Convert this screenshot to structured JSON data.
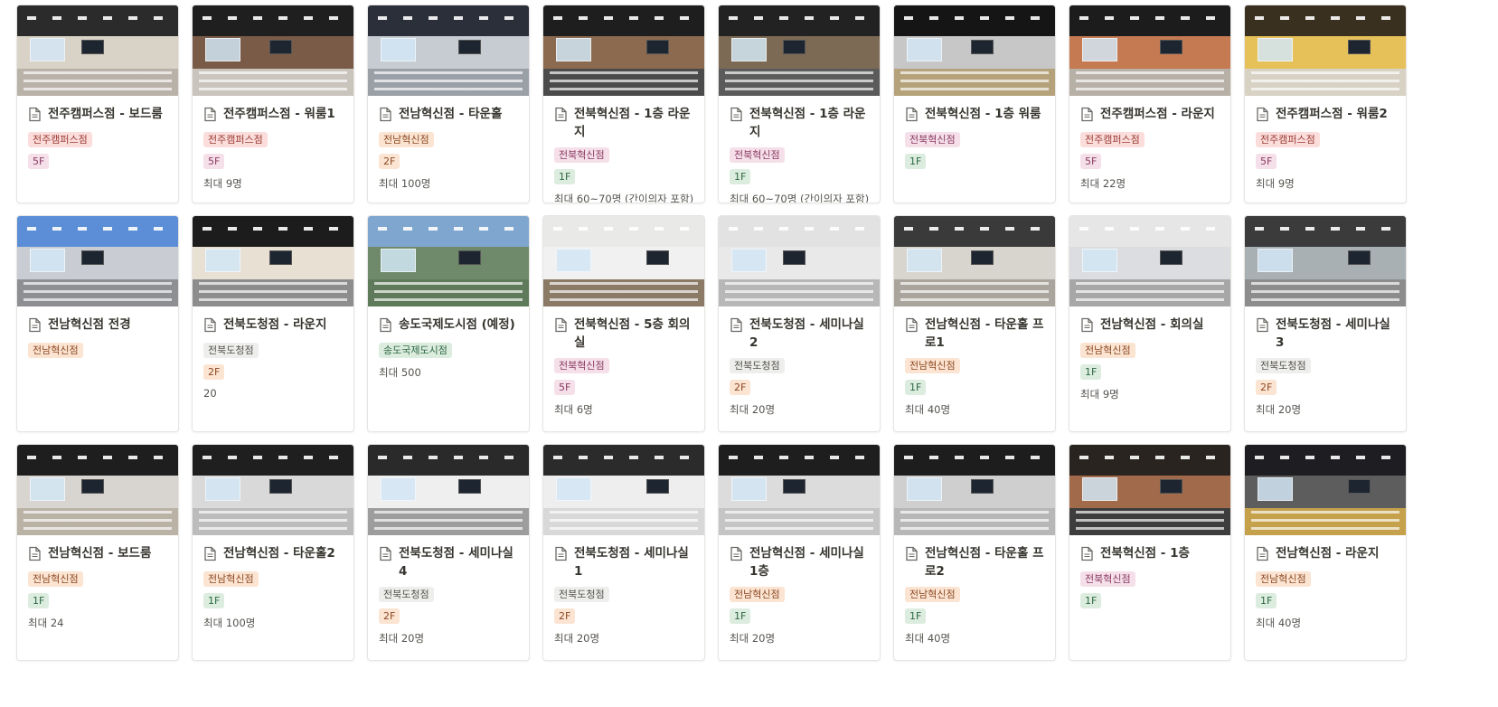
{
  "colors": {
    "tag_jeonnam": "#fbe4d2",
    "tag_jeonbuk": "#f5e0e9",
    "tag_jeonju": "#fbdedc",
    "tag_floor": "#dcecdf",
    "tag_gray": "#eeeeec"
  },
  "cards": [
    {
      "title": "전주캠퍼스점 - 보드룸",
      "branch": "전주캠퍼스점",
      "floor": "5F",
      "capacity": "",
      "cover": "file-icon"
    },
    {
      "title": "전주캠퍼스점 - 워룸1",
      "branch": "전주캠퍼스점",
      "floor": "5F",
      "capacity": "최대 9명"
    },
    {
      "title": "전남혁신점 - 타운홀",
      "branch": "전남혁신점",
      "floor": "2F",
      "capacity": "최대 100명"
    },
    {
      "title": "전북혁신점 - 1층 라운지",
      "branch": "전북혁신점",
      "floor": "1F",
      "capacity": "최대 60~70명 (간이의자 포함)"
    },
    {
      "title": "전북혁신점 - 1층 라운지",
      "branch": "전북혁신점",
      "floor": "1F",
      "capacity": "최대 60~70명 (간이의자 포함)"
    },
    {
      "title": "전북혁신점 - 1층 워룸",
      "branch": "전북혁신점",
      "floor": "1F",
      "capacity": ""
    },
    {
      "title": "전주캠퍼스점 - 라운지",
      "branch": "전주캠퍼스점",
      "floor": "5F",
      "capacity": "최대 22명"
    },
    {
      "title": "전주캠퍼스점 - 워룸2",
      "branch": "전주캠퍼스점",
      "floor": "5F",
      "capacity": "최대 9명"
    },
    {
      "title": "전남혁신점 전경",
      "branch": "전남혁신점",
      "floor": "",
      "capacity": ""
    },
    {
      "title": "전북도청점 - 라운지",
      "branch": "전북도청점",
      "floor": "2F",
      "capacity": "20"
    },
    {
      "title": "송도국제도시점 (예정)",
      "branch": "송도국제도시점",
      "floor": "",
      "capacity": "최대 500"
    },
    {
      "title": "전북혁신점 - 5층 회의실",
      "branch": "전북혁신점",
      "floor": "5F",
      "capacity": "최대 6명"
    },
    {
      "title": "전북도청점 - 세미나실2",
      "branch": "전북도청점",
      "floor": "2F",
      "capacity": "최대 20명"
    },
    {
      "title": "전남혁신점 - 타운홀 프로1",
      "branch": "전남혁신점",
      "floor": "1F",
      "capacity": "최대 40명"
    },
    {
      "title": "전남혁신점 - 회의실",
      "branch": "전남혁신점",
      "floor": "1F",
      "capacity": "최대 9명"
    },
    {
      "title": "전북도청점 - 세미나실3",
      "branch": "전북도청점",
      "floor": "2F",
      "capacity": "최대 20명"
    },
    {
      "title": "전남혁신점 - 보드룸",
      "branch": "전남혁신점",
      "floor": "1F",
      "capacity": "최대 24"
    },
    {
      "title": "전남혁신점 - 타운홀2",
      "branch": "전남혁신점",
      "floor": "1F",
      "capacity": "최대 100명"
    },
    {
      "title": "전북도청점 - 세미나실4",
      "branch": "전북도청점",
      "floor": "2F",
      "capacity": "최대 20명"
    },
    {
      "title": "전북도청점 - 세미나실1",
      "branch": "전북도청점",
      "floor": "2F",
      "capacity": "최대 20명"
    },
    {
      "title": "전남혁신점 - 세미나실 1층",
      "branch": "전남혁신점",
      "floor": "1F",
      "capacity": "최대 20명"
    },
    {
      "title": "전남혁신점 - 타운홀 프로2",
      "branch": "전남혁신점",
      "floor": "1F",
      "capacity": "최대 40명"
    },
    {
      "title": "전북혁신점 - 1층",
      "branch": "전북혁신점",
      "floor": "1F",
      "capacity": ""
    },
    {
      "title": "전남혁신점 - 라운지",
      "branch": "전남혁신점",
      "floor": "1F",
      "capacity": "최대 40명"
    }
  ]
}
